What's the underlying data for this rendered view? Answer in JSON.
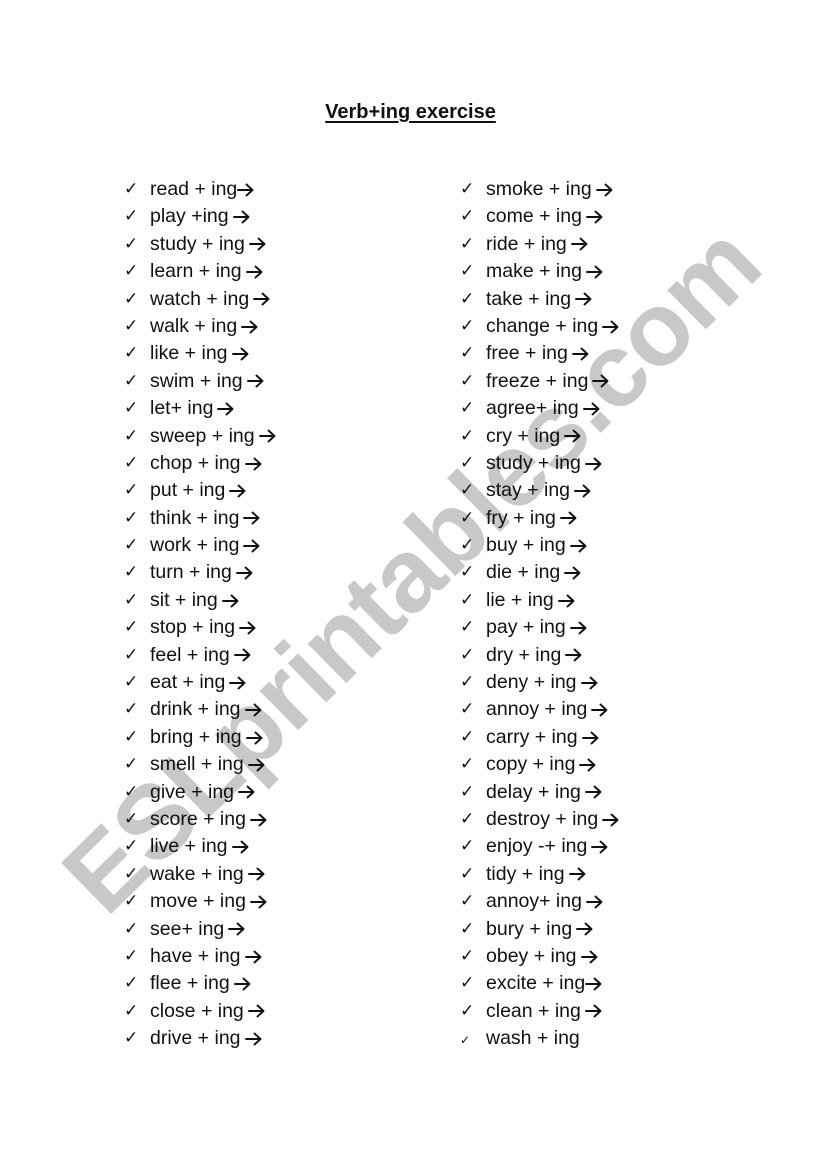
{
  "document": {
    "title": "Verb+ing exercise",
    "watermark": "ESLprintables.com",
    "colors": {
      "text": "#111111",
      "watermark": "#c8c8c8",
      "background": "#ffffff"
    },
    "icons": {
      "check": "check-mark-icon (✓)",
      "arrow": "right-arrow-icon (→)"
    }
  },
  "left_column": [
    {
      "text": "read + ing",
      "arrow": true,
      "arrow_tight": true
    },
    {
      "text": "play +ing",
      "arrow": true
    },
    {
      "text": "study + ing",
      "arrow": true
    },
    {
      "text": "learn + ing",
      "arrow": true
    },
    {
      "text": "watch + ing",
      "arrow": true
    },
    {
      "text": "walk + ing",
      "arrow": true
    },
    {
      "text": "like + ing",
      "arrow": true
    },
    {
      "text": "swim + ing",
      "arrow": true
    },
    {
      "text": "let+ ing",
      "arrow": true
    },
    {
      "text": "sweep + ing",
      "arrow": true
    },
    {
      "text": "chop + ing",
      "arrow": true
    },
    {
      "text": "put + ing",
      "arrow": true
    },
    {
      "text": "think + ing",
      "arrow": true
    },
    {
      "text": "work + ing",
      "arrow": true
    },
    {
      "text": "turn + ing",
      "arrow": true
    },
    {
      "text": "sit + ing",
      "arrow": true
    },
    {
      "text": "stop + ing",
      "arrow": true
    },
    {
      "text": "feel + ing",
      "arrow": true
    },
    {
      "text": "eat + ing",
      "arrow": true
    },
    {
      "text": "drink + ing",
      "arrow": true
    },
    {
      "text": "bring + ing",
      "arrow": true
    },
    {
      "text": "smell + ing",
      "arrow": true
    },
    {
      "text": "give + ing",
      "arrow": true
    },
    {
      "text": "score + ing",
      "arrow": true
    },
    {
      "text": "live + ing",
      "arrow": true
    },
    {
      "text": "wake + ing",
      "arrow": true
    },
    {
      "text": "move + ing",
      "arrow": true
    },
    {
      "text": "see+ ing",
      "arrow": true
    },
    {
      "text": "have + ing",
      "arrow": true
    },
    {
      "text": "flee + ing",
      "arrow": true
    },
    {
      "text": "close + ing",
      "arrow": true
    },
    {
      "text": "drive + ing",
      "arrow": true
    }
  ],
  "right_column": [
    {
      "text": "smoke + ing",
      "arrow": true
    },
    {
      "text": "come + ing",
      "arrow": true
    },
    {
      "text": "ride + ing",
      "arrow": true
    },
    {
      "text": "make + ing",
      "arrow": true
    },
    {
      "text": "take + ing",
      "arrow": true
    },
    {
      "text": "change + ing",
      "arrow": true
    },
    {
      "text": "free + ing",
      "arrow": true
    },
    {
      "text": "freeze + ing",
      "arrow": true
    },
    {
      "text": "agree+ ing",
      "arrow": true
    },
    {
      "text": "cry + ing",
      "arrow": true
    },
    {
      "text": "study + ing",
      "arrow": true
    },
    {
      "text": "stay + ing",
      "arrow": true
    },
    {
      "text": "fry + ing",
      "arrow": true
    },
    {
      "text": "buy + ing",
      "arrow": true
    },
    {
      "text": "die + ing",
      "arrow": true
    },
    {
      "text": "lie + ing",
      "arrow": true
    },
    {
      "text": "pay + ing",
      "arrow": true
    },
    {
      "text": "dry + ing",
      "arrow": true
    },
    {
      "text": "deny + ing",
      "arrow": true
    },
    {
      "text": "annoy + ing",
      "arrow": true
    },
    {
      "text": "carry + ing",
      "arrow": true
    },
    {
      "text": "copy + ing",
      "arrow": true
    },
    {
      "text": "delay + ing",
      "arrow": true
    },
    {
      "text": "destroy + ing",
      "arrow": true
    },
    {
      "text": "enjoy -+ ing",
      "arrow": true
    },
    {
      "text": "tidy + ing",
      "arrow": true
    },
    {
      "text": "annoy+ ing",
      "arrow": true
    },
    {
      "text": "bury + ing",
      "arrow": true
    },
    {
      "text": "obey + ing",
      "arrow": true
    },
    {
      "text": "excite + ing",
      "arrow": true,
      "arrow_tight": true
    },
    {
      "text": "clean + ing",
      "arrow": true
    },
    {
      "text": "wash + ing",
      "arrow": false,
      "small_check": true
    }
  ]
}
